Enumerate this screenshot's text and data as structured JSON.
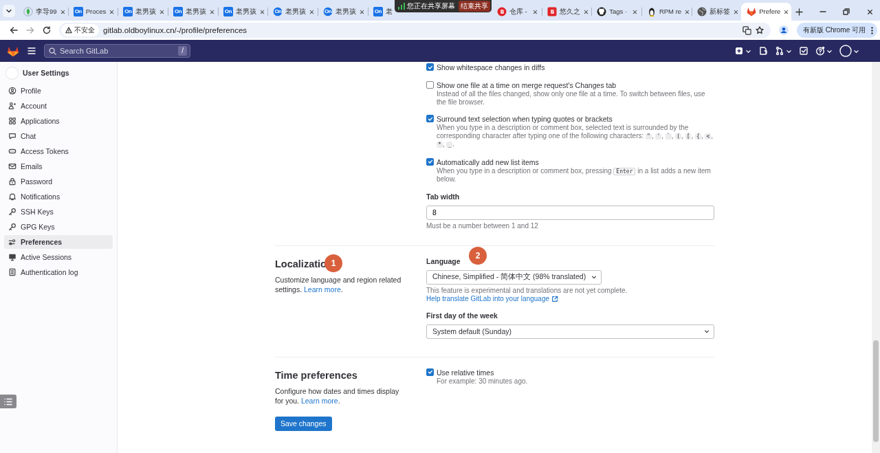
{
  "browser": {
    "tabs_left": [
      {
        "title": "李导99",
        "kind": "leaf",
        "selected": false
      },
      {
        "title": "Proces",
        "kind": "app-square",
        "badge": "On",
        "selected": false
      },
      {
        "title": "老男孩",
        "kind": "app-square",
        "badge": "On",
        "selected": false
      },
      {
        "title": "老男孩",
        "kind": "app-square",
        "badge": "On",
        "selected": false
      },
      {
        "title": "老男孩",
        "kind": "app-square",
        "badge": "On",
        "selected": false
      },
      {
        "title": "老男孩",
        "kind": "app-circle",
        "badge": "On",
        "selected": false
      },
      {
        "title": "老男孩",
        "kind": "app-circle",
        "badge": "On",
        "selected": false
      },
      {
        "title": "老",
        "kind": "app-square",
        "badge": "On",
        "selected": false
      }
    ],
    "share_bar": {
      "message": "您正在共享屏幕",
      "button": "结束共享"
    },
    "tabs_right": [
      {
        "title": "仓库 -",
        "kind": "round-logo",
        "selected": false
      },
      {
        "title": "悠久之",
        "kind": "square-logo",
        "selected": false
      },
      {
        "title": "Tags ·",
        "kind": "cat",
        "selected": false
      },
      {
        "title": "RPM re",
        "kind": "penguin",
        "selected": false
      },
      {
        "title": "新标签",
        "kind": "globe",
        "selected": false
      },
      {
        "title": "Prefere",
        "kind": "fox",
        "selected": true
      }
    ],
    "address": {
      "security": "不安全",
      "url": "gitlab.oldboylinux.cn/-/profile/preferences"
    },
    "update_button": "有新版 Chrome 可用"
  },
  "gitlab": {
    "search": {
      "placeholder": "Search GitLab",
      "shortcut": "/"
    },
    "actions": [
      {
        "kind": "create",
        "caret": true
      },
      {
        "kind": "issues",
        "caret": false
      },
      {
        "kind": "merge-requests",
        "caret": true
      },
      {
        "kind": "todo",
        "caret": false
      },
      {
        "kind": "help",
        "caret": true
      },
      {
        "kind": "user",
        "caret": true
      }
    ]
  },
  "sidebar": {
    "title": "User Settings",
    "items": [
      {
        "label": "Profile",
        "kind": "profile",
        "selected": false
      },
      {
        "label": "Account",
        "kind": "account",
        "selected": false
      },
      {
        "label": "Applications",
        "kind": "applications",
        "selected": false
      },
      {
        "label": "Chat",
        "kind": "chat",
        "selected": false
      },
      {
        "label": "Access Tokens",
        "kind": "token",
        "selected": false
      },
      {
        "label": "Emails",
        "kind": "email",
        "selected": false
      },
      {
        "label": "Password",
        "kind": "password",
        "selected": false
      },
      {
        "label": "Notifications",
        "kind": "notifications",
        "selected": false
      },
      {
        "label": "SSH Keys",
        "kind": "key",
        "selected": false
      },
      {
        "label": "GPG Keys",
        "kind": "key",
        "selected": false
      },
      {
        "label": "Preferences",
        "kind": "preferences",
        "selected": true
      },
      {
        "label": "Active Sessions",
        "kind": "sessions",
        "selected": false
      },
      {
        "label": "Authentication log",
        "kind": "log",
        "selected": false
      }
    ]
  },
  "behavior": [
    {
      "kind": "checkbox",
      "label": "Show whitespace changes in diffs",
      "checked": true
    },
    {
      "kind": "checkbox",
      "label": "Show one file at a time on merge request's Changes tab",
      "checked": false,
      "help": [
        {
          "text": "Instead of all the files changed, show only one file at a time. To switch between files, use the file browser."
        }
      ]
    },
    {
      "kind": "checkbox",
      "label": "Surround text selection when typing quotes or brackets",
      "checked": true,
      "help": [
        {
          "text": "When you type in a description or comment box, selected text is surrounded by the corresponding character after typing one of the following characters: "
        },
        {
          "code": "\""
        },
        {
          "text": ", "
        },
        {
          "code": "'"
        },
        {
          "text": ", "
        },
        {
          "code": "`"
        },
        {
          "text": ", "
        },
        {
          "code": "("
        },
        {
          "text": ", "
        },
        {
          "code": "["
        },
        {
          "text": ", "
        },
        {
          "code": "{"
        },
        {
          "text": ", "
        },
        {
          "code": "<"
        },
        {
          "text": ", "
        },
        {
          "code": "*"
        },
        {
          "text": ", "
        },
        {
          "code": "_"
        },
        {
          "text": "."
        }
      ]
    },
    {
      "kind": "checkbox",
      "label": "Automatically add new list items",
      "checked": true,
      "help": [
        {
          "text": "When you type in a description or comment box, pressing "
        },
        {
          "code": "Enter"
        },
        {
          "text": " in a list adds a new item below."
        }
      ]
    },
    {
      "kind": "number",
      "label": "Tab width",
      "value": "8",
      "help": [
        {
          "text": "Must be a number between 1 and 12"
        }
      ]
    }
  ],
  "localization": {
    "title": "Localizatio",
    "marker": "1",
    "description": [
      {
        "text": "Customize language and region related settings. "
      },
      {
        "link": "Learn more"
      },
      {
        "text": "."
      }
    ],
    "fields": [
      {
        "kind": "dropdown",
        "label": "Language",
        "marker": "2",
        "value": "Chinese, Simplified - 简体中文 (98% translated)",
        "help": "This feature is experimental and translations are not yet complete.",
        "help_link": "Help translate GitLab into your language"
      },
      {
        "kind": "select",
        "label": "First day of the week",
        "value": "System default (Sunday)"
      }
    ]
  },
  "time": {
    "title": "Time preferences",
    "description": [
      {
        "text": "Configure how dates and times display for you. "
      },
      {
        "link": "Learn more"
      },
      {
        "text": "."
      }
    ],
    "options": [
      {
        "kind": "checkbox",
        "label": "Use relative times",
        "checked": true,
        "help": [
          {
            "text": "For example: 30 minutes ago."
          }
        ]
      }
    ]
  },
  "save_button": "Save changes"
}
